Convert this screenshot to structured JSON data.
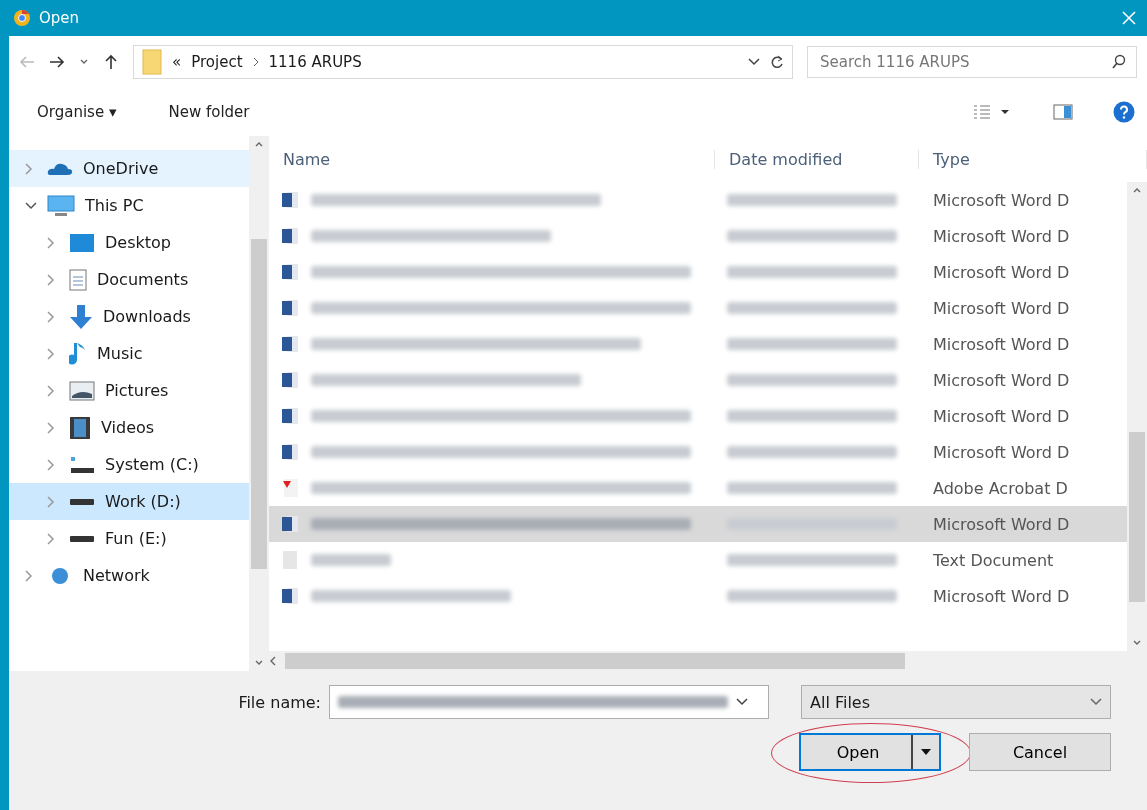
{
  "window": {
    "title": "Open"
  },
  "nav": {
    "path": [
      "Project",
      "1116 ARUPS"
    ],
    "path_prefix": "«",
    "search": {
      "placeholder": "Search 1116 ARUPS"
    }
  },
  "toolbar": {
    "organise": "Organise ▾",
    "new_folder": "New folder"
  },
  "sidebar": {
    "items": [
      {
        "label": "OneDrive",
        "expanded": false,
        "selected": false,
        "hover": true
      },
      {
        "label": "This PC",
        "expanded": true,
        "selected": false,
        "hover": false,
        "children": [
          {
            "label": "Desktop",
            "expanded": false,
            "selected": false,
            "hover": false
          },
          {
            "label": "Documents",
            "expanded": false,
            "selected": false,
            "hover": false
          },
          {
            "label": "Downloads",
            "expanded": false,
            "selected": false,
            "hover": false
          },
          {
            "label": "Music",
            "expanded": false,
            "selected": false,
            "hover": false
          },
          {
            "label": "Pictures",
            "expanded": false,
            "selected": false,
            "hover": false
          },
          {
            "label": "Videos",
            "expanded": false,
            "selected": false,
            "hover": false
          },
          {
            "label": "System (C:)",
            "expanded": false,
            "selected": false,
            "hover": false
          },
          {
            "label": "Work (D:)",
            "expanded": false,
            "selected": true,
            "hover": false
          },
          {
            "label": "Fun (E:)",
            "expanded": false,
            "selected": false,
            "hover": false
          }
        ]
      },
      {
        "label": "Network",
        "expanded": false,
        "selected": false,
        "hover": false
      }
    ]
  },
  "table": {
    "columns": [
      "Name",
      "Date modified",
      "Type"
    ],
    "rows": [
      {
        "kind": "word",
        "selected": false,
        "type": "Microsoft Word D"
      },
      {
        "kind": "word",
        "selected": false,
        "type": "Microsoft Word D"
      },
      {
        "kind": "word",
        "selected": false,
        "type": "Microsoft Word D"
      },
      {
        "kind": "word",
        "selected": false,
        "type": "Microsoft Word D"
      },
      {
        "kind": "word",
        "selected": false,
        "type": "Microsoft Word D"
      },
      {
        "kind": "word",
        "selected": false,
        "type": "Microsoft Word D"
      },
      {
        "kind": "word",
        "selected": false,
        "type": "Microsoft Word D"
      },
      {
        "kind": "word",
        "selected": false,
        "type": "Microsoft Word D"
      },
      {
        "kind": "pdf",
        "selected": false,
        "type": "Adobe Acrobat D"
      },
      {
        "kind": "word",
        "selected": true,
        "type": "Microsoft Word D"
      },
      {
        "kind": "text",
        "selected": false,
        "type": "Text Document"
      },
      {
        "kind": "word",
        "selected": false,
        "type": "Microsoft Word D"
      }
    ]
  },
  "footer": {
    "file_name_label": "File name:",
    "filter": "All Files",
    "open": "Open",
    "cancel": "Cancel",
    "open_highlighted": true
  }
}
